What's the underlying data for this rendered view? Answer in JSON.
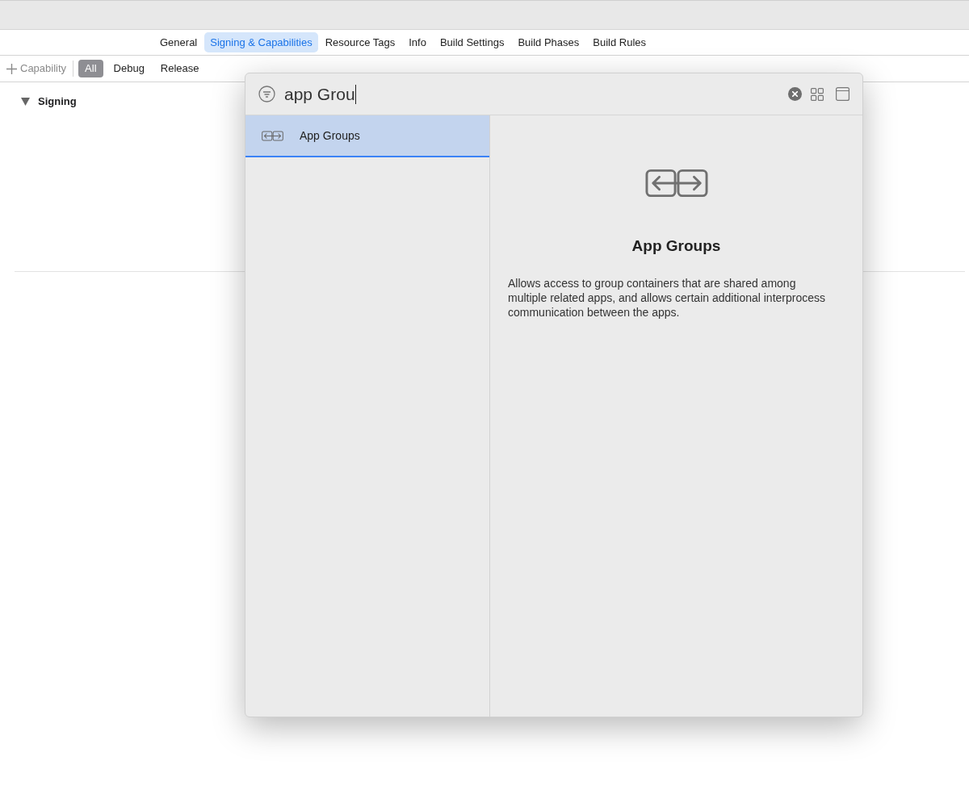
{
  "tabs": [
    {
      "label": "General",
      "selected": false
    },
    {
      "label": "Signing & Capabilities",
      "selected": true
    },
    {
      "label": "Resource Tags",
      "selected": false
    },
    {
      "label": "Info",
      "selected": false
    },
    {
      "label": "Build Settings",
      "selected": false
    },
    {
      "label": "Build Phases",
      "selected": false
    },
    {
      "label": "Build Rules",
      "selected": false
    }
  ],
  "filter_bar": {
    "add_label": "Capability",
    "configurations": [
      {
        "label": "All",
        "selected": true
      },
      {
        "label": "Debug",
        "selected": false
      },
      {
        "label": "Release",
        "selected": false
      }
    ]
  },
  "section": {
    "title": "Signing",
    "expanded": true
  },
  "library": {
    "search": {
      "value": "app Grou"
    },
    "results": [
      {
        "label": "App Groups",
        "selected": true
      }
    ],
    "detail": {
      "title": "App Groups",
      "description": "Allows access to group containers that are shared among multiple related apps, and allows certain additional interprocess communication between the apps."
    }
  }
}
